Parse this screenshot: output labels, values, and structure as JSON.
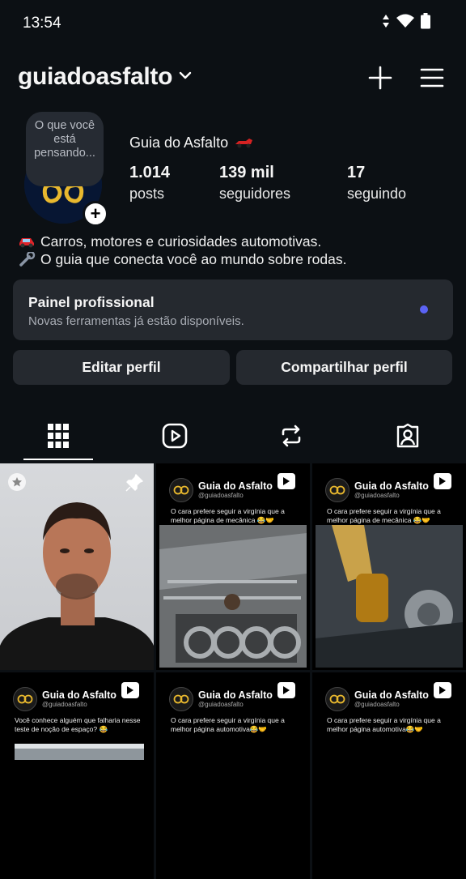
{
  "status_bar": {
    "time": "13:54"
  },
  "header": {
    "username": "guiadoasfalto"
  },
  "profile": {
    "thought_bubble": "O que você está pensando...",
    "display_name": "Guia do Asfalto",
    "stats": [
      {
        "value": "1.014",
        "label": "posts"
      },
      {
        "value": "139 mil",
        "label": "seguidores"
      },
      {
        "value": "17",
        "label": "seguindo"
      }
    ],
    "bio": [
      "Carros, motores e curiosidades automotivas.",
      "O guia que conecta você ao mundo sobre rodas."
    ]
  },
  "panel": {
    "title": "Painel profissional",
    "subtitle": "Novas ferramentas já estão disponíveis."
  },
  "buttons": {
    "edit": "Editar perfil",
    "share": "Compartilhar perfil"
  },
  "posts": {
    "reel_name": "Guia do Asfalto",
    "reel_handle": "@guiadoasfalto",
    "captions": [
      "O cara prefere seguir a virgínia que a melhor página de mecânica 😂🤝",
      "O cara prefere seguir a virgínia que a melhor página de mecânica 😂🤝",
      "Você conhece alguém que falharia nesse teste de noção de espaço? 😂",
      "O cara prefere seguir a virgínia que a melhor página automotiva😂🤝",
      "O cara prefere seguir a virgínia que a melhor página automotiva😂🤝"
    ]
  },
  "colors": {
    "background": "#0c1014",
    "card": "#25292f",
    "accent_dot": "#5b63f5"
  }
}
